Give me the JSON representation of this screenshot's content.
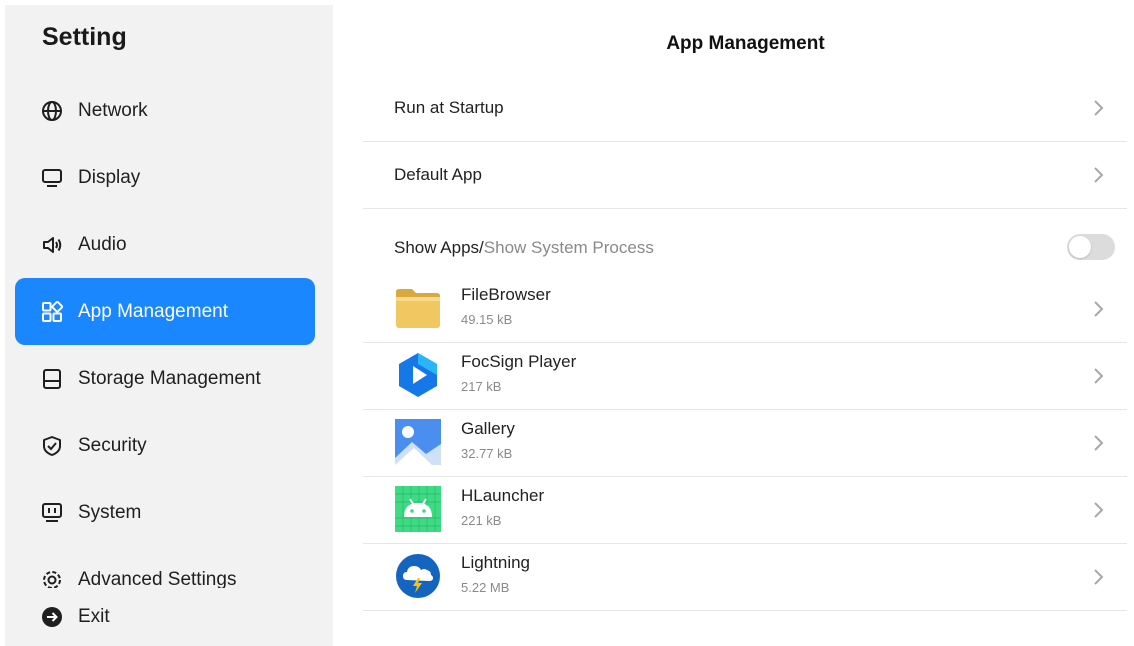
{
  "sidebar": {
    "title": "Setting",
    "items": [
      {
        "label": "Network",
        "icon": "globe-icon"
      },
      {
        "label": "Display",
        "icon": "monitor-icon"
      },
      {
        "label": "Audio",
        "icon": "speaker-icon"
      },
      {
        "label": "App Management",
        "icon": "apps-grid-icon",
        "active": true
      },
      {
        "label": "Storage Management",
        "icon": "storage-icon"
      },
      {
        "label": "Security",
        "icon": "shield-check-icon"
      },
      {
        "label": "System",
        "icon": "system-monitor-icon"
      },
      {
        "label": "Advanced Settings",
        "icon": "gear-icon"
      }
    ],
    "exit_label": "Exit"
  },
  "main": {
    "title": "App Management",
    "rows": [
      {
        "label": "Run at Startup"
      },
      {
        "label": "Default App"
      }
    ],
    "toggle": {
      "label_primary": "Show Apps/",
      "label_secondary": "Show System Process",
      "on": false
    },
    "apps": [
      {
        "name": "FileBrowser",
        "size": "49.15 kB",
        "icon": "folder-icon"
      },
      {
        "name": "FocSign Player",
        "size": "217 kB",
        "icon": "play-hexagon-icon"
      },
      {
        "name": "Gallery",
        "size": "32.77 kB",
        "icon": "gallery-icon"
      },
      {
        "name": "HLauncher",
        "size": "221 kB",
        "icon": "android-icon"
      },
      {
        "name": "Lightning",
        "size": "5.22 MB",
        "icon": "cloud-bolt-icon"
      }
    ]
  },
  "colors": {
    "accent": "#1a86ff",
    "sidebar_bg": "#f2f2f2",
    "muted_text": "#8a8a8a"
  }
}
